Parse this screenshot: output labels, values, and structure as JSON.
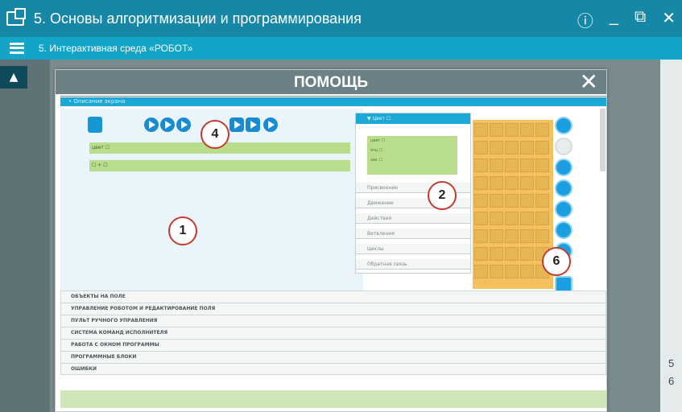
{
  "app": {
    "title": "5. Основы алгоритмизации и программирования",
    "subtitle": "5. Интерактивная среда «РОБОТ»",
    "window_controls": {
      "info": "ⓘ",
      "minimize": "_",
      "restore": "⧉",
      "close": "✕"
    }
  },
  "sidebar": {
    "user_icon": "▲"
  },
  "right_panel": {
    "page_numbers": [
      "5",
      "6"
    ]
  },
  "help": {
    "title": "ПОМОЩЬ",
    "close": "✕",
    "current_section": "• Описание экрана",
    "program_rows": [
      "цвет ☐",
      "☐ + ☐"
    ],
    "command_panel": {
      "header": "▼ Цвет ☐",
      "group_items": [
        "цвет ☐",
        "ячц ☐",
        "зак ☐"
      ],
      "items": [
        "Присвоение",
        "Движение",
        "Действия",
        "Ветвления",
        "Циклы",
        "Обратная связь"
      ]
    },
    "callouts": [
      "1",
      "2",
      "4",
      "6"
    ],
    "sections": [
      "ОБЪЕКТЫ НА ПОЛЕ",
      "УПРАВЛЕНИЕ РОБОТОМ И РЕДАКТИРОВАНИЕ ПОЛЯ",
      "ПУЛЬТ РУЧНОГО УПРАВЛЕНИЯ",
      "СИСТЕМА КОМАНД ИСПОЛНИТЕЛЯ",
      "РАБОТА С ОКНОМ ПРОГРАММЫ",
      "ПРОГРАММНЫЕ БЛОКИ",
      "ОШИБКИ"
    ]
  }
}
